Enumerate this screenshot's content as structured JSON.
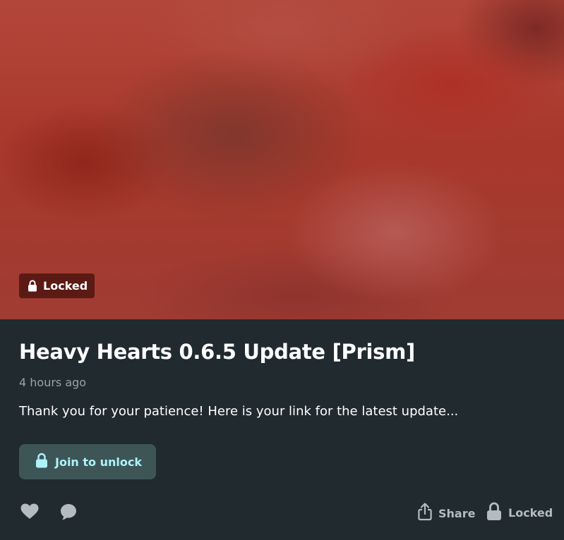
{
  "post": {
    "badge_label": "Locked",
    "title": "Heavy Hearts 0.6.5 Update [Prism]",
    "time": "4 hours ago",
    "teaser": "Thank you for your patience! Here is your link for the latest update...",
    "join_label": "Join to unlock"
  },
  "actions": {
    "like_icon": "heart-icon",
    "comment_icon": "comment-icon",
    "share_label": "Share",
    "share_icon": "share-icon",
    "locked_label": "Locked",
    "locked_icon": "lock-icon"
  },
  "colors": {
    "background": "#202a2f",
    "accent": "#aef3f7",
    "button": "#3e5557",
    "badge": "#5c1a14"
  }
}
